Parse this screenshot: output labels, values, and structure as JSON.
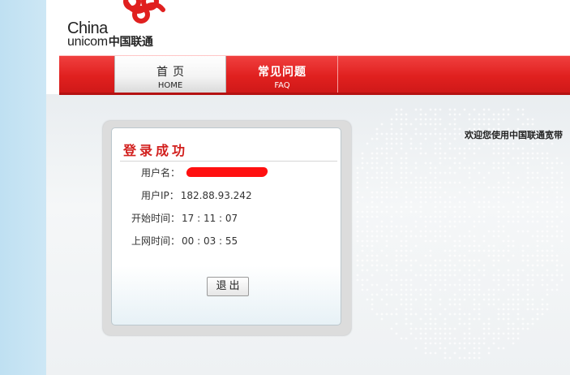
{
  "logo": {
    "china": "China",
    "unicom": "unicom",
    "cn_name": "中国联通"
  },
  "nav": {
    "tabs": [
      {
        "cn": "首页",
        "en": "HOME"
      },
      {
        "cn": "常见问题",
        "en": "FAQ"
      }
    ]
  },
  "welcome": "欢迎您使用中国联通宽带",
  "login_box": {
    "title": "登录成功",
    "rows": [
      {
        "label": "用户名：",
        "value": ""
      },
      {
        "label": "用户IP：",
        "value": "182.88.93.242"
      },
      {
        "label": "开始时间：",
        "value": "17 : 11 : 07"
      },
      {
        "label": "上网时间：",
        "value": "00 : 03 : 55"
      }
    ],
    "logout_label": "退出"
  },
  "colors": {
    "brand_red": "#e0201f",
    "title_red": "#d2201e",
    "redaction": "#ff1010",
    "sidebar_blue": "#c7e4f4"
  },
  "icons": {
    "logo_knot": "china-unicom-knot-icon"
  }
}
